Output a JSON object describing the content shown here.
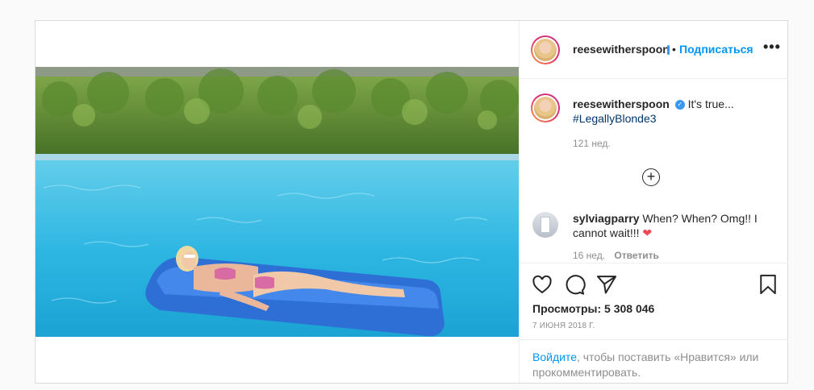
{
  "header": {
    "username": "reesewitherspoon",
    "separator": "•",
    "follow_label": "Подписаться",
    "more_label": "•••"
  },
  "caption": {
    "username": "reesewitherspoon",
    "text": "It's true...",
    "hashtag": "#LegallyBlonde3",
    "time": "121 нед."
  },
  "comments": [
    {
      "username": "sylviagparry",
      "text": "When? When? Omg!! I cannot wait!!!",
      "emoji": "❤",
      "time": "16 нед.",
      "reply_label": "Ответить"
    }
  ],
  "stats": {
    "views": "Просмотры: 5 308 046",
    "date": "7 ИЮНЯ 2018 Г."
  },
  "login": {
    "link_label": "Войдите",
    "rest": ", чтобы поставить «Нравится» или прокомментировать."
  },
  "icons": {
    "like": "heart-icon",
    "comment": "comment-icon",
    "share": "paper-plane-icon",
    "save": "bookmark-icon",
    "load_more": "plus-circle-icon",
    "verified": "verified-badge-icon"
  },
  "colors": {
    "accent": "#0095f6",
    "verified": "#3897f0",
    "heart_emoji": "#ed4956",
    "pool_water": "#2fb7e3",
    "float": "#2e6fd6"
  }
}
